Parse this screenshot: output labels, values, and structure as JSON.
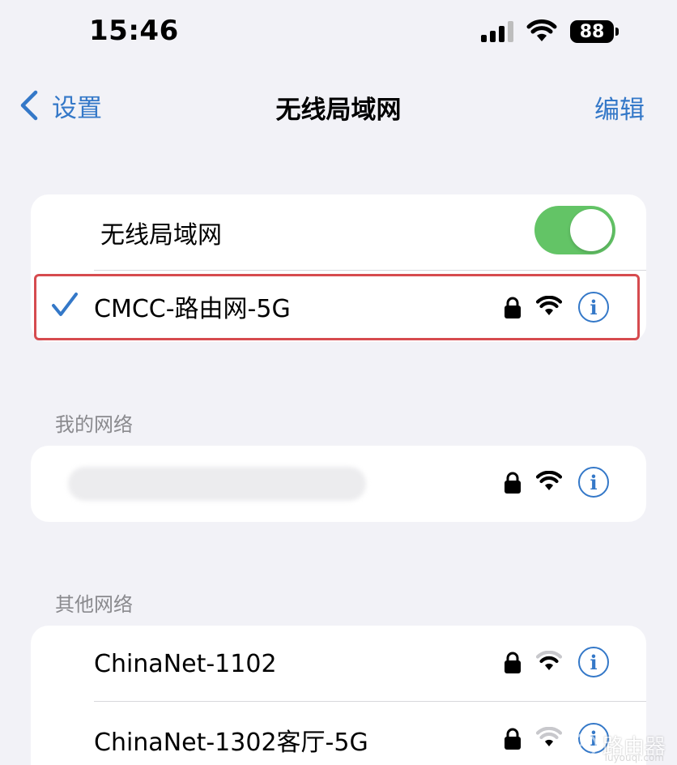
{
  "status_bar": {
    "time": "15:46",
    "battery": "88"
  },
  "nav": {
    "back_label": "设置",
    "title": "无线局域网",
    "edit_label": "编辑"
  },
  "wifi_card": {
    "toggle_label": "无线局域网",
    "toggle_on": true,
    "connected_network": "CMCC-路由网-5G"
  },
  "my_networks": {
    "header": "我的网络"
  },
  "other_networks": {
    "header": "其他网络",
    "items": [
      {
        "name": "ChinaNet-1102",
        "secured": true
      },
      {
        "name": "ChinaNet-1302客厅-5G",
        "secured": true
      }
    ]
  },
  "watermark": {
    "text": "路由器",
    "sub": "luyouqi.com"
  },
  "colors": {
    "accent": "#3478c8",
    "toggle_on": "#63c466",
    "highlight": "#d64b4f",
    "background": "#f2f2f7"
  }
}
